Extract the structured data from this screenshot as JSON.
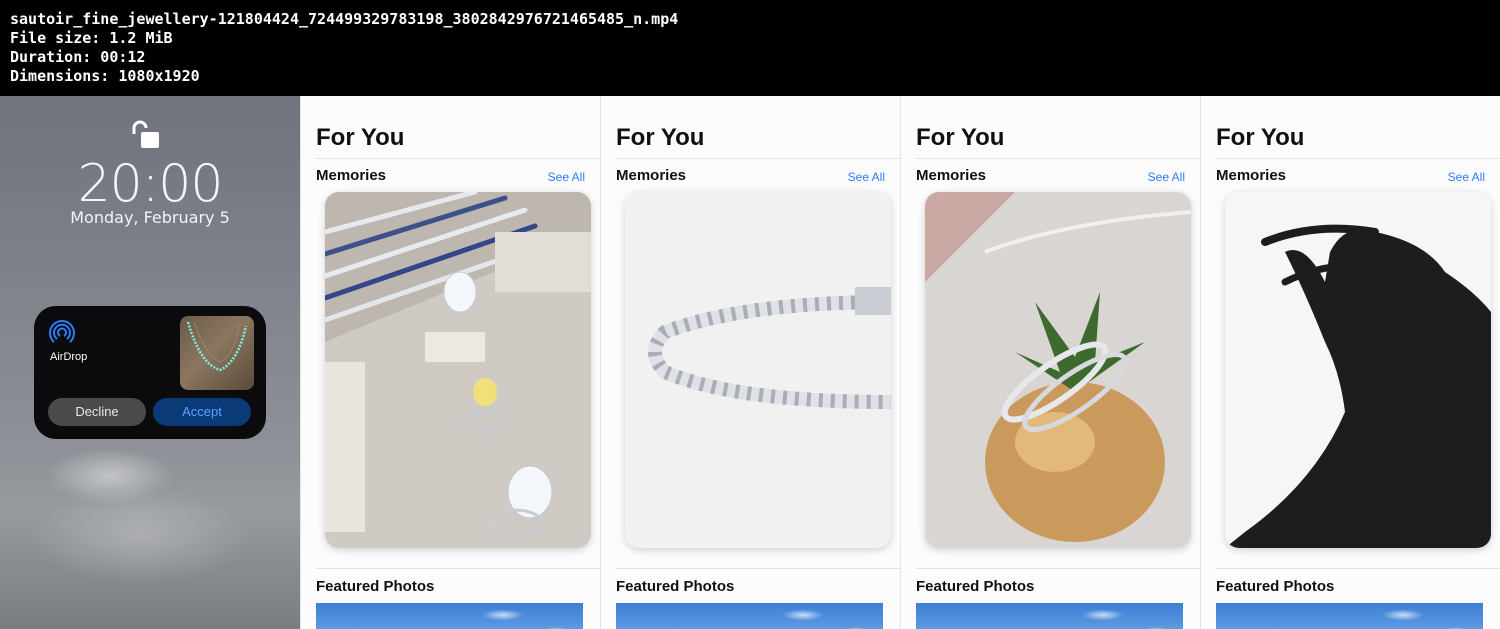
{
  "file_info": {
    "filename": "sautoir_fine_jewellery-121804424_724499329783198_3802842976721465485_n.mp4",
    "file_size": "File size: 1.2 MiB",
    "duration": "Duration: 00:12",
    "dimensions": "Dimensions: 1080x1920"
  },
  "lock_screen": {
    "time": "20:00",
    "date": "Monday, February 5",
    "airdrop": {
      "label": "AirDrop",
      "decline_label": "Decline",
      "accept_label": "Accept"
    }
  },
  "photos_frames": [
    {
      "title": "For You",
      "memories_label": "Memories",
      "see_all_label": "See All",
      "featured_label": "Featured Photos"
    },
    {
      "title": "For You",
      "memories_label": "Memories",
      "see_all_label": "See All",
      "featured_label": "Featured Photos"
    },
    {
      "title": "For You",
      "memories_label": "Memories",
      "see_all_label": "See All",
      "featured_label": "Featured Photos"
    },
    {
      "title": "For You",
      "memories_label": "Memories",
      "see_all_label": "See All",
      "featured_label": "Featured Photos"
    }
  ],
  "colors": {
    "link_blue": "#2d7cf6",
    "accept_bg": "#0a3a78",
    "decline_bg": "#4a4a4d"
  }
}
